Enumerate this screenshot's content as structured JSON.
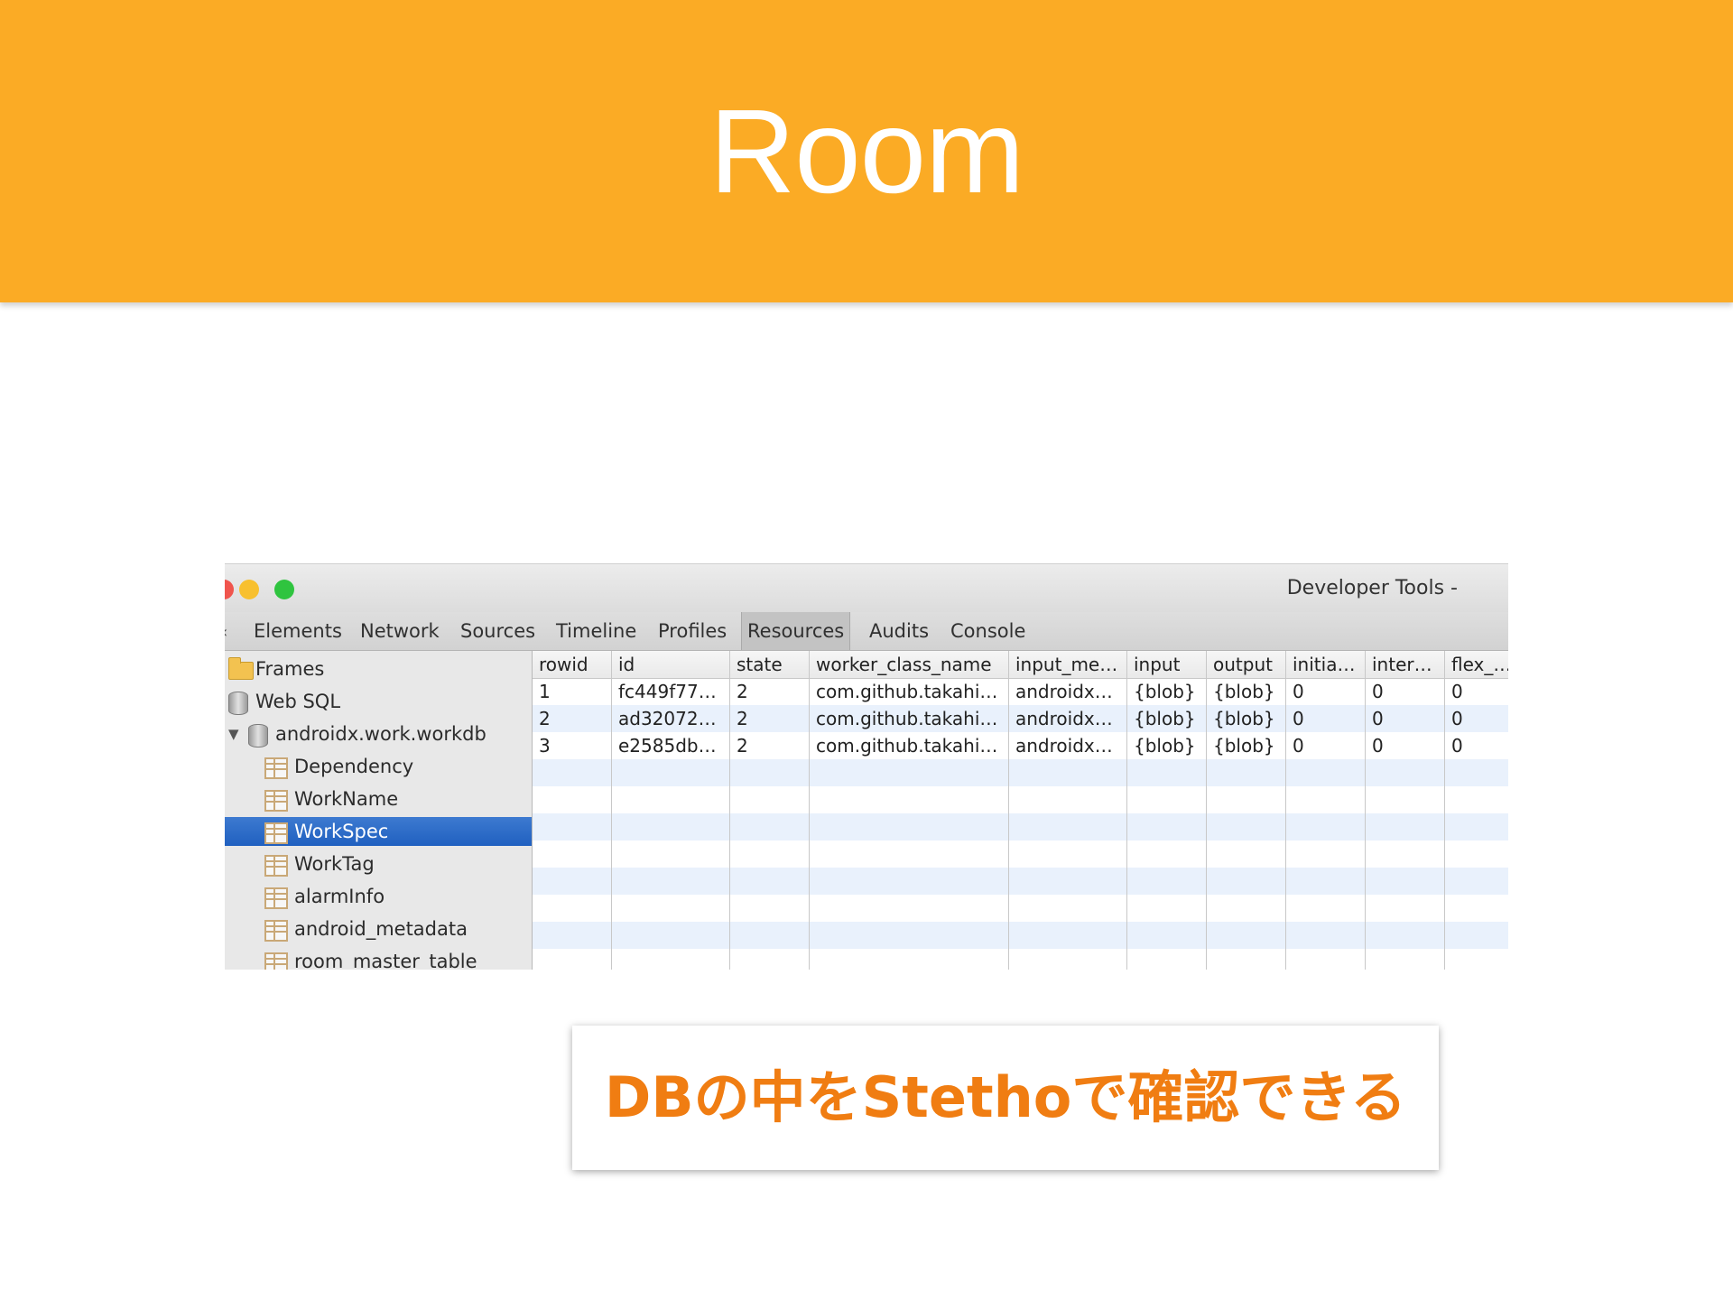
{
  "slide": {
    "title": "Room",
    "caption": "DBの中をStethoで確認できる",
    "colors": {
      "header": "#fbab25",
      "caption": "#f07d12"
    }
  },
  "window": {
    "title": "Developer Tools -"
  },
  "toolbar": {
    "tabs": [
      "Elements",
      "Network",
      "Sources",
      "Timeline",
      "Profiles",
      "Resources",
      "Audits",
      "Console"
    ],
    "active_tab": "Resources"
  },
  "sidebar": {
    "items": [
      {
        "label": "Frames",
        "icon": "folder-icon"
      },
      {
        "label": "Web SQL",
        "icon": "database-icon"
      },
      {
        "label": "androidx.work.workdb",
        "icon": "database-icon",
        "expanded": true
      },
      {
        "label": "Dependency",
        "icon": "table-icon"
      },
      {
        "label": "WorkName",
        "icon": "table-icon"
      },
      {
        "label": "WorkSpec",
        "icon": "table-icon",
        "selected": true
      },
      {
        "label": "WorkTag",
        "icon": "table-icon"
      },
      {
        "label": "alarmInfo",
        "icon": "table-icon"
      },
      {
        "label": "android_metadata",
        "icon": "table-icon"
      },
      {
        "label": "room_master_table",
        "icon": "table-icon"
      }
    ]
  },
  "table": {
    "columns": [
      "rowid",
      "id",
      "state",
      "worker_class_name",
      "input_me…",
      "input",
      "output",
      "initia…",
      "inter…",
      "flex_…"
    ],
    "rows": [
      [
        "1",
        "fc449f77…",
        "2",
        "com.github.takahi…",
        "androidx…",
        "{blob}",
        "{blob}",
        "0",
        "0",
        "0"
      ],
      [
        "2",
        "ad32072…",
        "2",
        "com.github.takahi…",
        "androidx…",
        "{blob}",
        "{blob}",
        "0",
        "0",
        "0"
      ],
      [
        "3",
        "e2585db…",
        "2",
        "com.github.takahi…",
        "androidx…",
        "{blob}",
        "{blob}",
        "0",
        "0",
        "0"
      ]
    ]
  }
}
